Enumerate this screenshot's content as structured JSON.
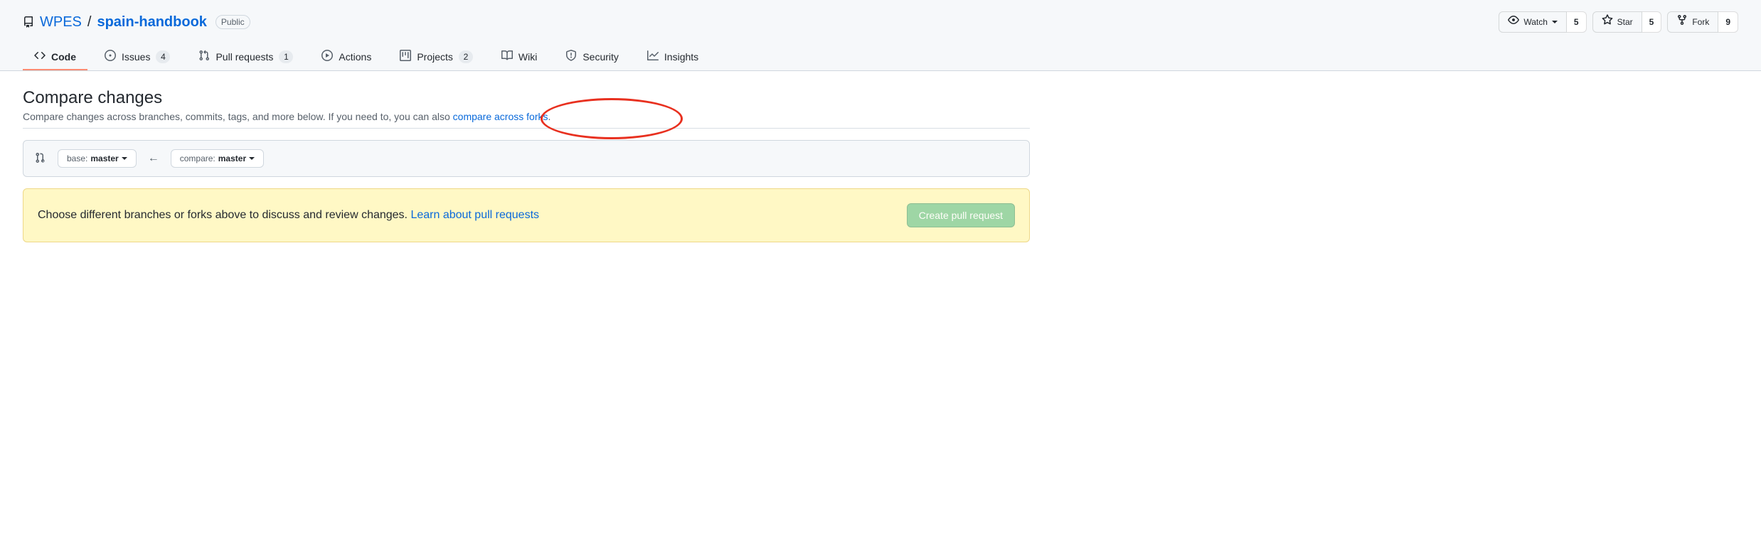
{
  "repo": {
    "owner": "WPES",
    "name": "spain-handbook",
    "visibility": "Public"
  },
  "actions": {
    "watch_label": "Watch",
    "watch_count": "5",
    "star_label": "Star",
    "star_count": "5",
    "fork_label": "Fork",
    "fork_count": "9"
  },
  "nav": {
    "code": "Code",
    "issues": "Issues",
    "issues_count": "4",
    "pulls": "Pull requests",
    "pulls_count": "1",
    "actions": "Actions",
    "projects": "Projects",
    "projects_count": "2",
    "wiki": "Wiki",
    "security": "Security",
    "insights": "Insights"
  },
  "compare": {
    "heading": "Compare changes",
    "sub_pre": "Compare changes across branches, commits, tags, and more below. If you need to, you can also ",
    "sub_link": "compare across forks",
    "sub_post": ".",
    "base_label": "base: ",
    "base_value": "master",
    "compare_label": "compare: ",
    "compare_value": "master"
  },
  "flash": {
    "text_pre": "Choose different branches or forks above to discuss and review changes. ",
    "learn_link": "Learn about pull requests",
    "create_btn": "Create pull request"
  }
}
